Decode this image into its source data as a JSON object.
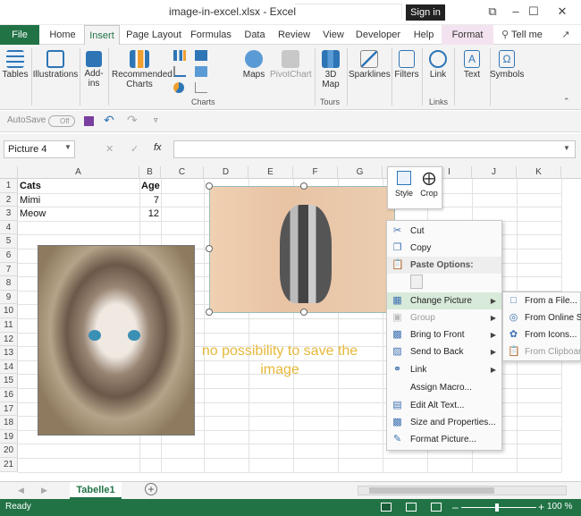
{
  "window": {
    "title": "image-in-excel.xlsx  -  Excel",
    "signin": "Sign in",
    "min": "–",
    "max": "☐",
    "close": "✕",
    "restore": "⧉"
  },
  "tabs": [
    "File",
    "Home",
    "Insert",
    "Page Layout",
    "Formulas",
    "Data",
    "Review",
    "View",
    "Developer",
    "Help",
    "Format"
  ],
  "tellme": "Tell me",
  "ribbon": {
    "tables": "Tables",
    "illustrations": "Illustrations",
    "addins": "Add-ins",
    "recommended_charts": "Recommended Charts",
    "maps": "Maps",
    "pivotchart": "PivotChart",
    "threed_map": "3D Map",
    "sparklines": "Sparklines",
    "filters": "Filters",
    "link": "Link",
    "text": "Text",
    "symbols": "Symbols",
    "group_charts": "Charts",
    "group_tours": "Tours",
    "group_links": "Links"
  },
  "qat": {
    "autosave": "AutoSave",
    "toggle": "Off"
  },
  "formula_bar": {
    "namebox": "Picture 4",
    "fx": "fx",
    "cancel": "✕",
    "enter": "✓"
  },
  "columns": [
    "A",
    "B",
    "C",
    "D",
    "E",
    "F",
    "G",
    "H",
    "I",
    "J",
    "K"
  ],
  "rows": [
    "1",
    "2",
    "3",
    "4",
    "5",
    "6",
    "7",
    "8",
    "9",
    "10",
    "11",
    "12",
    "13",
    "14",
    "15",
    "16",
    "17",
    "18",
    "19",
    "20",
    "21"
  ],
  "cells": {
    "a1": "Cats",
    "b1": "Age",
    "a2": "Mimi",
    "b2": "7",
    "a3": "Meow",
    "b3": "12"
  },
  "annotation": "no possibility to save the image",
  "mini_toolbar": {
    "style": "Style",
    "crop": "Crop"
  },
  "context_menu": {
    "cut": "Cut",
    "copy": "Copy",
    "paste_options": "Paste Options:",
    "change_picture": "Change Picture",
    "group": "Group",
    "bring_to_front": "Bring to Front",
    "send_to_back": "Send to Back",
    "link": "Link",
    "assign_macro": "Assign Macro...",
    "edit_alt_text": "Edit Alt Text...",
    "size_and_properties": "Size and Properties...",
    "format_picture": "Format Picture..."
  },
  "submenu": {
    "from_file": "From a File...",
    "from_online": "From Online So",
    "from_icons": "From Icons...",
    "from_clipboard": "From Clipboard"
  },
  "sheet": {
    "tab": "Tabelle1",
    "add": "+"
  },
  "status": {
    "ready": "Ready",
    "zoom": "100 %",
    "minus": "–",
    "plus": "+"
  },
  "colors": {
    "excel_green": "#217346",
    "warn_text": "#e6b83a",
    "highlight": "#d8ead9"
  }
}
